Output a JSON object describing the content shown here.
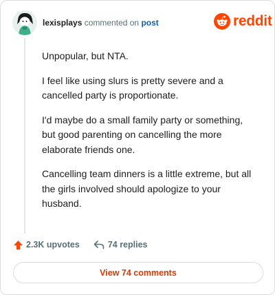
{
  "header": {
    "username": "lexisplays",
    "action_text": "commented on",
    "post_link": "post",
    "brand_name": "reddit",
    "brand_color": "#ff4500"
  },
  "comment": {
    "paragraphs": [
      "Unpopular, but NTA.",
      "I feel like using slurs is pretty severe and a cancelled party is proportionate.",
      "I'd maybe do a small family party or something, but good parenting on cancelling the more elaborate friends one.",
      "Cancelling team dinners is a little extreme, but all the girls involved should apologize to your husband."
    ]
  },
  "stats": {
    "upvotes": "2.3K upvotes",
    "replies": "74 replies",
    "upvote_color": "#ff4500"
  },
  "footer": {
    "view_comments_label": "View 74 comments",
    "accent_color": "#d93a00"
  },
  "icons": {
    "brand_logo": "reddit-snoo-icon",
    "upvote": "upvote-arrow-icon",
    "reply": "reply-arrow-icon"
  }
}
